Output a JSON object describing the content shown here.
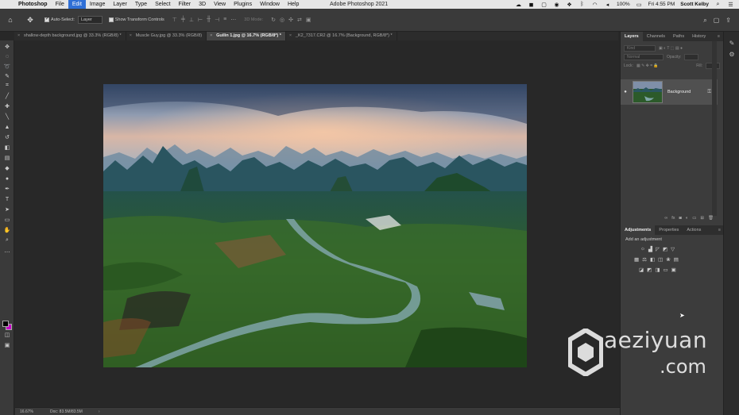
{
  "menubar": {
    "app_name": "Photoshop",
    "items": [
      "File",
      "Edit",
      "Image",
      "Layer",
      "Type",
      "Select",
      "Filter",
      "3D",
      "View",
      "Plugins",
      "Window",
      "Help"
    ],
    "active_item": "Edit",
    "window_title": "Adobe Photoshop 2021",
    "battery": "100%",
    "clock": "Fri 4:55 PM",
    "user": "Scott Kelby"
  },
  "options": {
    "auto_select_label": "Auto-Select:",
    "auto_select_value": "Layer",
    "transform_label": "Show Transform Controls",
    "mode_3d": "3D Mode:"
  },
  "tabs": [
    {
      "label": "shallow-depth background.jpg @ 33.3% (RGB/8) *",
      "active": false
    },
    {
      "label": "Muscle Guy.jpg @ 33.3% (RGB/8)",
      "active": false
    },
    {
      "label": "Guilin 1.jpg @ 16.7% (RGB/8*) *",
      "active": true
    },
    {
      "label": "_K2_7317.CR2 @ 16.7% (Background, RGB/8*) *",
      "active": false
    }
  ],
  "status": {
    "zoom": "16.67%",
    "doc": "Doc: 83.5M/83.5M"
  },
  "layers_panel": {
    "tabs": [
      "Layers",
      "Channels",
      "Paths",
      "History"
    ],
    "active_tab": "Layers",
    "kind_placeholder": "Kind",
    "blend_mode": "Normal",
    "opacity_label": "Opacity:",
    "lock_label": "Lock:",
    "fill_label": "Fill:",
    "layer_name": "Background"
  },
  "adjustments_panel": {
    "tabs": [
      "Adjustments",
      "Properties",
      "Actions"
    ],
    "active_tab": "Adjustments",
    "title": "Add an adjustment"
  },
  "watermark": {
    "line1": "aeziyuan",
    "line2": ".com"
  },
  "colors": {
    "foreground": "#000000",
    "background": "#c800c8",
    "menu_highlight": "#2f6fd6"
  }
}
